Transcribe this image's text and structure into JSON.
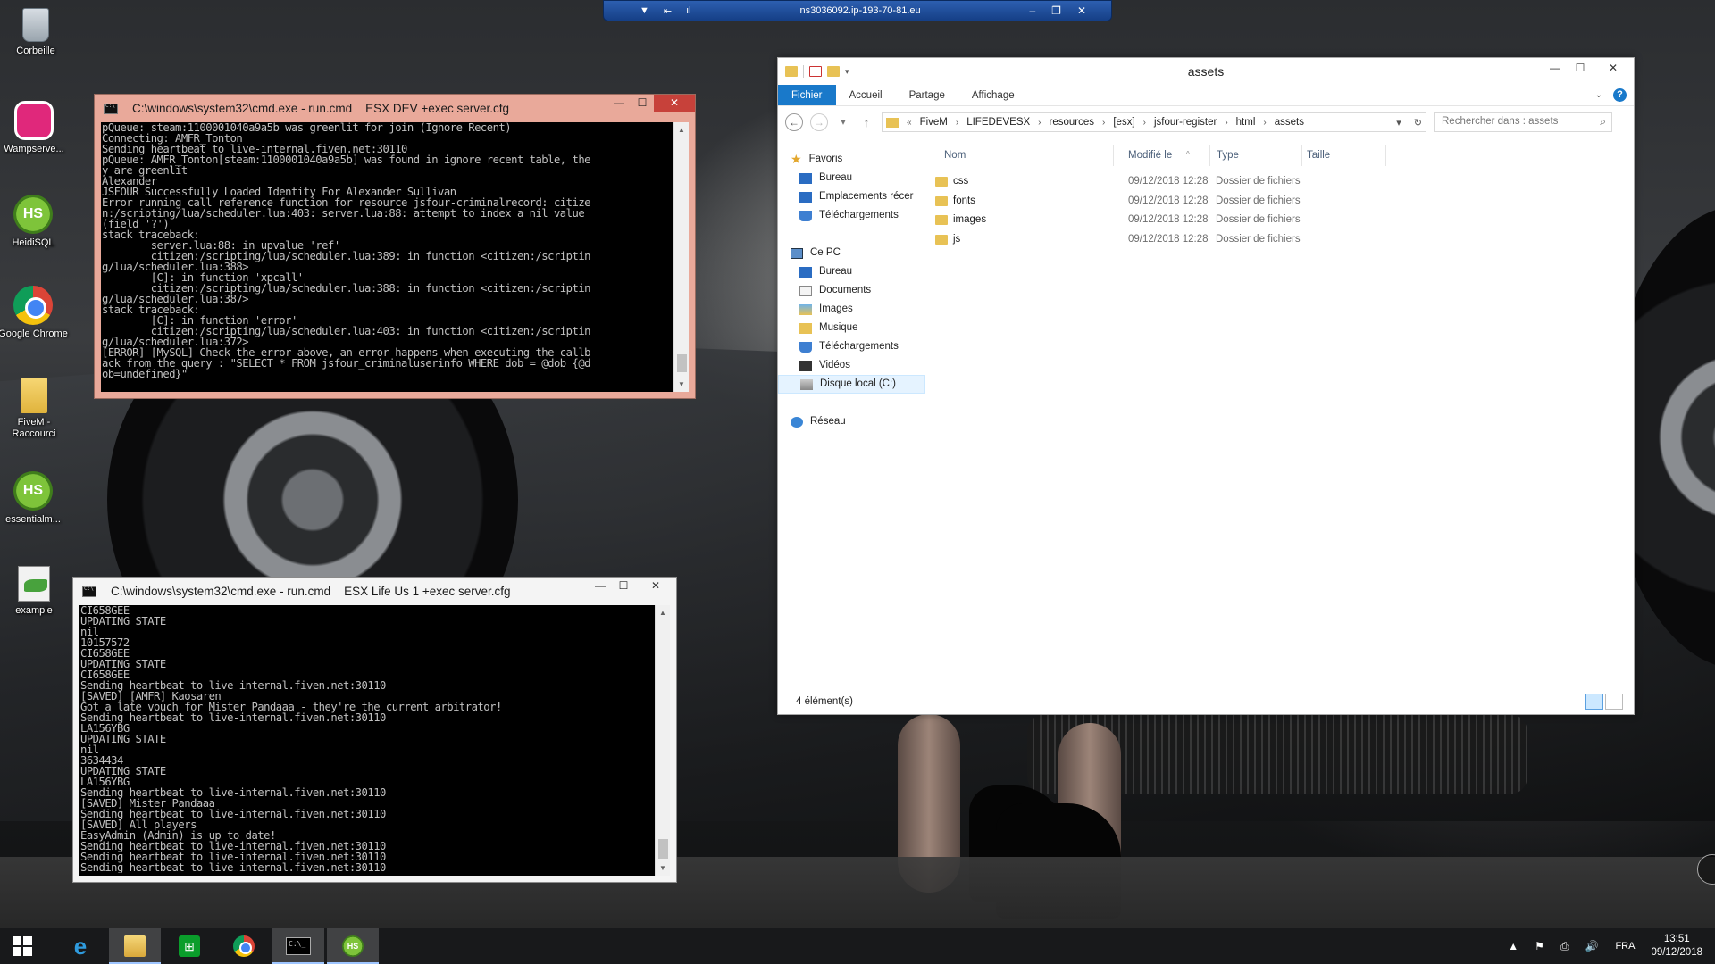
{
  "desktop_icons": [
    {
      "label": "Corbeille",
      "icon": "recycle-bin-icon"
    },
    {
      "label": "Wampserve...",
      "icon": "wampserver-icon"
    },
    {
      "label": "HeidiSQL",
      "icon": "heidisql-icon"
    },
    {
      "label": "Google Chrome",
      "icon": "chrome-icon"
    },
    {
      "label": "FiveM - Raccourci",
      "icon": "folder-shortcut-icon"
    },
    {
      "label": "essentialm...",
      "icon": "heidisql-icon"
    },
    {
      "label": "example",
      "icon": "document-icon"
    }
  ],
  "rdp_bar": {
    "title": "ns3036092.ip-193-70-81.eu",
    "pin": "▼",
    "signal": "ıl",
    "minimize": "–",
    "restore": "❐",
    "close": "✕"
  },
  "cmd_dev": {
    "title": "C:\\windows\\system32\\cmd.exe - run.cmd    ESX DEV +exec server.cfg",
    "minimize": "—",
    "maximize": "☐",
    "close": "✕",
    "lines": [
      "pQueue: steam:1100001040a9a5b was greenlit for join (Ignore Recent)",
      "Connecting: AMFR_Tonton",
      "Sending heartbeat to live-internal.fiven.net:30110",
      "pQueue: AMFR_Tonton[steam:1100001040a9a5b] was found in ignore recent table, the",
      "y are greenlit",
      "Alexander",
      "JSFOUR Successfully Loaded Identity For Alexander Sullivan",
      "Error running call reference function for resource jsfour-criminalrecord: citize",
      "n:/scripting/lua/scheduler.lua:403: server.lua:88: attempt to index a nil value",
      "(field '?')",
      "stack traceback:",
      "        server.lua:88: in upvalue 'ref'",
      "        citizen:/scripting/lua/scheduler.lua:389: in function <citizen:/scriptin",
      "g/lua/scheduler.lua:388>",
      "        [C]: in function 'xpcall'",
      "        citizen:/scripting/lua/scheduler.lua:388: in function <citizen:/scriptin",
      "g/lua/scheduler.lua:387>",
      "stack traceback:",
      "        [C]: in function 'error'",
      "        citizen:/scripting/lua/scheduler.lua:403: in function <citizen:/scriptin",
      "g/lua/scheduler.lua:372>",
      "[ERROR] [MySQL] Check the error above, an error happens when executing the callb",
      "ack from the query : \"SELECT * FROM jsfour_criminaluserinfo WHERE dob = @dob {@d",
      "ob=undefined}\"",
      "_"
    ]
  },
  "cmd_life": {
    "title": "C:\\windows\\system32\\cmd.exe - run.cmd    ESX Life Us 1 +exec server.cfg",
    "minimize": "—",
    "maximize": "☐",
    "close": "✕",
    "lines": [
      "CI658GEE",
      "UPDATING STATE",
      "nil",
      "10157572",
      "CI658GEE",
      "UPDATING STATE",
      "CI658GEE",
      "Sending heartbeat to live-internal.fiven.net:30110",
      "[SAVED] [AMFR] Kaosaren",
      "Got a late vouch for Mister Pandaaa - they're the current arbitrator!",
      "Sending heartbeat to live-internal.fiven.net:30110",
      "LA156YBG",
      "UPDATING STATE",
      "nil",
      "3634434",
      "UPDATING STATE",
      "LA156YBG",
      "Sending heartbeat to live-internal.fiven.net:30110",
      "[SAVED] Mister Pandaaa",
      "Sending heartbeat to live-internal.fiven.net:30110",
      "[SAVED] All players",
      "EasyAdmin (Admin) is up to date!",
      "Sending heartbeat to live-internal.fiven.net:30110",
      "Sending heartbeat to live-internal.fiven.net:30110",
      "Sending heartbeat to live-internal.fiven.net:30110"
    ]
  },
  "explorer": {
    "title": "assets",
    "minimize": "—",
    "maximize": "☐",
    "close": "✕",
    "ribbon_tabs": [
      "Fichier",
      "Accueil",
      "Partage",
      "Affichage"
    ],
    "help": "?",
    "nav_back": "←",
    "nav_forward": "→",
    "nav_recent": "▾",
    "nav_up": "↑",
    "breadcrumb_prefix": "«",
    "breadcrumb": [
      "FiveM",
      "LIFEDEVESX",
      "resources",
      "[esx]",
      "jsfour-register",
      "html",
      "assets"
    ],
    "address_dropdown": "▾",
    "refresh": "↻",
    "search_placeholder": "Rechercher dans : assets",
    "search_icon": "⌕",
    "tree": [
      {
        "label": "Favoris",
        "icon": "star-icon",
        "indent": 0
      },
      {
        "label": "Bureau",
        "icon": "desktop-icon",
        "indent": 1
      },
      {
        "label": "Emplacements récer",
        "icon": "recent-places-icon",
        "indent": 1
      },
      {
        "label": "Téléchargements",
        "icon": "download-icon",
        "indent": 1
      },
      {
        "label": "",
        "icon": "",
        "indent": 0
      },
      {
        "label": "Ce PC",
        "icon": "computer-icon",
        "indent": 0
      },
      {
        "label": "Bureau",
        "icon": "desktop-icon",
        "indent": 1
      },
      {
        "label": "Documents",
        "icon": "documents-icon",
        "indent": 1
      },
      {
        "label": "Images",
        "icon": "pictures-icon",
        "indent": 1
      },
      {
        "label": "Musique",
        "icon": "music-icon",
        "indent": 1
      },
      {
        "label": "Téléchargements",
        "icon": "download-icon",
        "indent": 1
      },
      {
        "label": "Vidéos",
        "icon": "videos-icon",
        "indent": 1
      },
      {
        "label": "Disque local (C:)",
        "icon": "disk-icon",
        "indent": 1,
        "selected": true
      },
      {
        "label": "",
        "icon": "",
        "indent": 0
      },
      {
        "label": "Réseau",
        "icon": "network-icon",
        "indent": 0
      }
    ],
    "columns": {
      "name": "Nom",
      "modified": "Modifié le",
      "type": "Type",
      "size": "Taille",
      "sort_indicator": "^"
    },
    "files": [
      {
        "name": "css",
        "modified": "09/12/2018 12:28",
        "type": "Dossier de fichiers",
        "size": ""
      },
      {
        "name": "fonts",
        "modified": "09/12/2018 12:28",
        "type": "Dossier de fichiers",
        "size": ""
      },
      {
        "name": "images",
        "modified": "09/12/2018 12:28",
        "type": "Dossier de fichiers",
        "size": ""
      },
      {
        "name": "js",
        "modified": "09/12/2018 12:28",
        "type": "Dossier de fichiers",
        "size": ""
      }
    ],
    "status": "4 élément(s)"
  },
  "taskbar": {
    "items": [
      {
        "name": "start-button",
        "icon": "windows-icon",
        "active": false
      },
      {
        "name": "taskbar-ie",
        "icon": "internet-explorer-icon",
        "active": false
      },
      {
        "name": "taskbar-explorer",
        "icon": "file-explorer-icon",
        "active": true
      },
      {
        "name": "taskbar-store",
        "icon": "store-icon",
        "active": false
      },
      {
        "name": "taskbar-chrome",
        "icon": "chrome-icon",
        "active": false
      },
      {
        "name": "taskbar-cmd",
        "icon": "cmd-icon",
        "active": true
      },
      {
        "name": "taskbar-heidisql",
        "icon": "heidisql-icon",
        "active": true
      }
    ],
    "tray_symbols": [
      "▲",
      "⚑",
      "⎙",
      "🔊"
    ],
    "language": "FRA",
    "time": "13:51",
    "date": "09/12/2018"
  }
}
